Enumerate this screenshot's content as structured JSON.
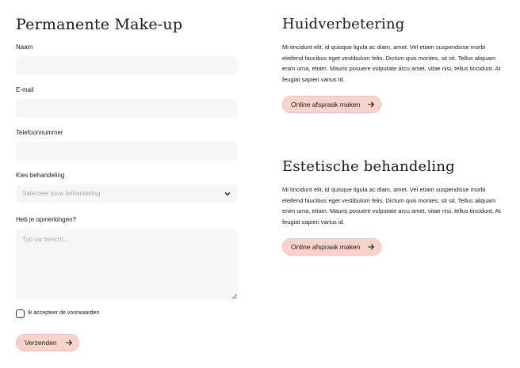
{
  "form": {
    "title": "Permanente Make-up",
    "fields": {
      "name": {
        "label": "Naam",
        "value": "",
        "placeholder": ""
      },
      "email": {
        "label": "E-mail",
        "value": "",
        "placeholder": ""
      },
      "phone": {
        "label": "Telefoonnummer",
        "value": "",
        "placeholder": ""
      },
      "treatment": {
        "label": "Kies behandeling",
        "placeholder": "Selecteer jouw behandeling"
      },
      "remarks": {
        "label": "Heb je opmerkingen?",
        "value": "",
        "placeholder": "Typ uw bericht..."
      }
    },
    "terms": {
      "label": "Ik accepteer de voorwaarden",
      "checked": false
    },
    "submit_label": "Verzenden"
  },
  "sections": [
    {
      "title": "Huidverbetering",
      "body": "Mi tincidunt elit, id quisque ligula ac diam, amet. Vel etiam suspendisse morbi eleifend faucibus eget vestibulum felis. Dictum quis montes, sit sit. Tellus aliquam enim urna, etiam. Mauris posuere vulputate arcu amet, vitae nisi, tellus tincidunt. At feugiat sapien varius id.",
      "button_label": "Online afspraak maken"
    },
    {
      "title": "Estetische behandeling",
      "body": "Mi tincidunt elit, id quisque ligula ac diam, amet. Vel etiam suspendisse morbi eleifend faucibus eget vestibulum felis. Dictum quis montes, sit sit. Tellus aliquam enim urna, etiam. Mauris posuere vulputate arcu amet, vitae nisi, tellus tincidunt. At feugiat sapien varius id.",
      "button_label": "Online afspraak maken"
    }
  ],
  "icons": {
    "select": "chevron-down-icon",
    "button": "arrow-right-icon",
    "textarea": "resize-grip-icon"
  },
  "colors": {
    "button_bg": "#f8d3cc",
    "input_bg": "#f6f6f6",
    "text": "#1a1a1a",
    "placeholder": "#a9a9a9"
  }
}
